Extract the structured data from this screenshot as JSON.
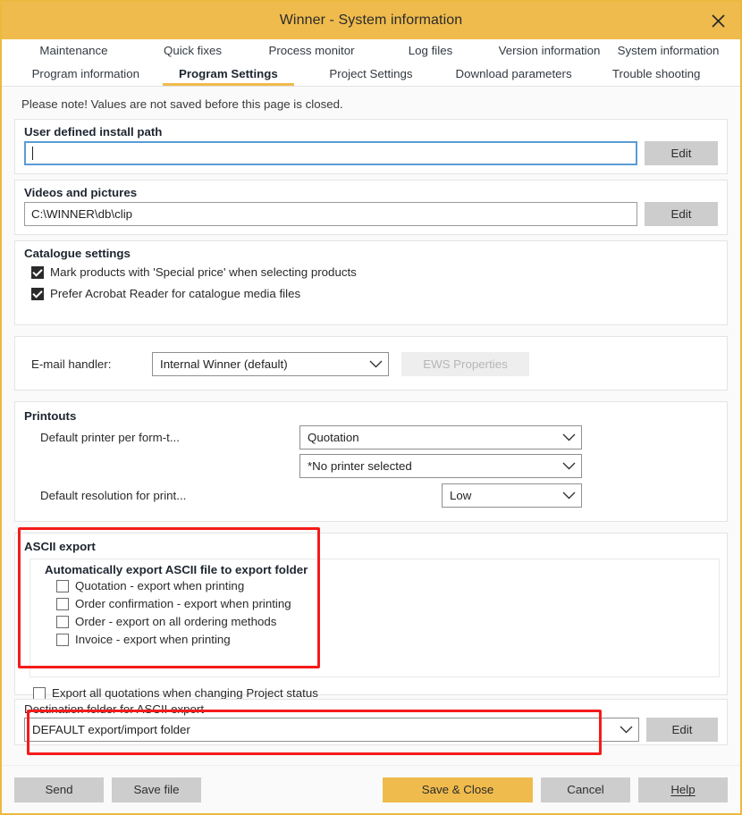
{
  "window": {
    "title": "Winner - System information",
    "close_icon": "close-icon"
  },
  "tabs": {
    "row1": [
      {
        "label": "Maintenance",
        "active": false
      },
      {
        "label": "Quick fixes",
        "active": false
      },
      {
        "label": "Process monitor",
        "active": false
      },
      {
        "label": "Log files",
        "active": false
      },
      {
        "label": "Version information",
        "active": false
      },
      {
        "label": "System information",
        "active": false
      }
    ],
    "row2": [
      {
        "label": "Program information",
        "active": false
      },
      {
        "label": "Program Settings",
        "active": true
      },
      {
        "label": "Project Settings",
        "active": false
      },
      {
        "label": "Download parameters",
        "active": false
      },
      {
        "label": "Trouble shooting",
        "active": false
      }
    ]
  },
  "notice": "Please note! Values are not saved before this page is closed.",
  "install_path": {
    "title": "User defined install path",
    "value": "",
    "edit_label": "Edit"
  },
  "videos_pictures": {
    "title": "Videos and pictures",
    "value": "C:\\WINNER\\db\\clip",
    "edit_label": "Edit"
  },
  "catalogue": {
    "title": "Catalogue settings",
    "options": [
      {
        "label": "Mark products with 'Special price' when selecting products",
        "checked": true
      },
      {
        "label": "Prefer Acrobat Reader for catalogue media files",
        "checked": true
      }
    ]
  },
  "email": {
    "label": "E-mail handler:",
    "value": "Internal Winner (default)",
    "properties_label": "EWS Properties",
    "properties_disabled": true
  },
  "printouts": {
    "title": "Printouts",
    "default_printer_label": "Default printer per form-t...",
    "form_type_value": "Quotation",
    "printer_value": "*No printer selected",
    "resolution_label": "Default resolution for print...",
    "resolution_value": "Low"
  },
  "ascii_export": {
    "title": "ASCII export",
    "subtitle": "Automatically export ASCII file to export folder",
    "options": [
      {
        "label": "Quotation - export when printing",
        "checked": false
      },
      {
        "label": "Order confirmation - export when printing",
        "checked": false
      },
      {
        "label": "Order  - export on all ordering methods",
        "checked": false
      },
      {
        "label": "Invoice - export when printing",
        "checked": false
      }
    ],
    "export_all_label": "Export all quotations when changing Project status",
    "export_all_checked": false,
    "destination_title": "Destination folder for ASCII export",
    "destination_value": "DEFAULT export/import folder",
    "destination_edit_label": "Edit"
  },
  "footer": {
    "send_label": "Send",
    "save_file_label": "Save file",
    "save_close_label": "Save & Close",
    "cancel_label": "Cancel",
    "help_label": "Help"
  },
  "colors": {
    "accent": "#efbb4d",
    "highlight": "#f51b1b",
    "focus": "#5b9bd5",
    "button": "#cdcdcd"
  }
}
